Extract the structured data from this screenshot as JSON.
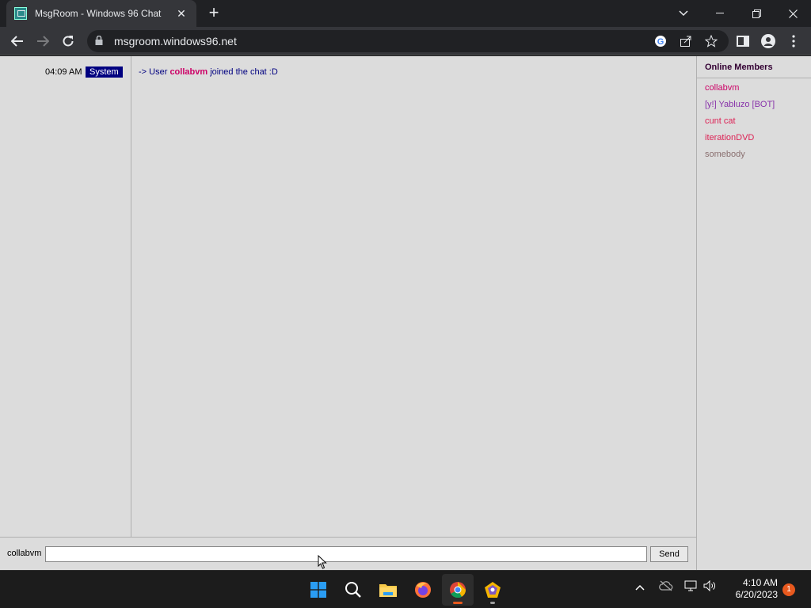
{
  "browser": {
    "tab_title": "MsgRoom - Windows 96 Chat",
    "tab_close": "✕",
    "new_tab": "+",
    "url": "msgroom.windows96.net"
  },
  "chat": {
    "messages": [
      {
        "time": "04:09 AM",
        "sender": "System",
        "prefix": "-> User",
        "username": "collabvm",
        "suffix": "joined the chat :D"
      }
    ]
  },
  "members": {
    "heading": "Online Members",
    "list": [
      {
        "name": "collabvm",
        "color": "#cc0066"
      },
      {
        "name": "[y!] Yabluzo [BOT]",
        "color": "#8833aa"
      },
      {
        "name": "cunt cat",
        "color": "#dd2255"
      },
      {
        "name": "iterationDVD",
        "color": "#dd2255"
      },
      {
        "name": "somebody",
        "color": "#8a7070"
      }
    ]
  },
  "input": {
    "nickname": "collabvm",
    "value": "",
    "send_label": "Send"
  },
  "taskbar": {
    "time": "4:10 AM",
    "date": "6/20/2023",
    "notification_count": "1"
  },
  "colors": {
    "system_badge_bg": "#000080",
    "message_text": "#000080",
    "username_highlight": "#cc0066",
    "page_bg": "#dcdcdc"
  }
}
